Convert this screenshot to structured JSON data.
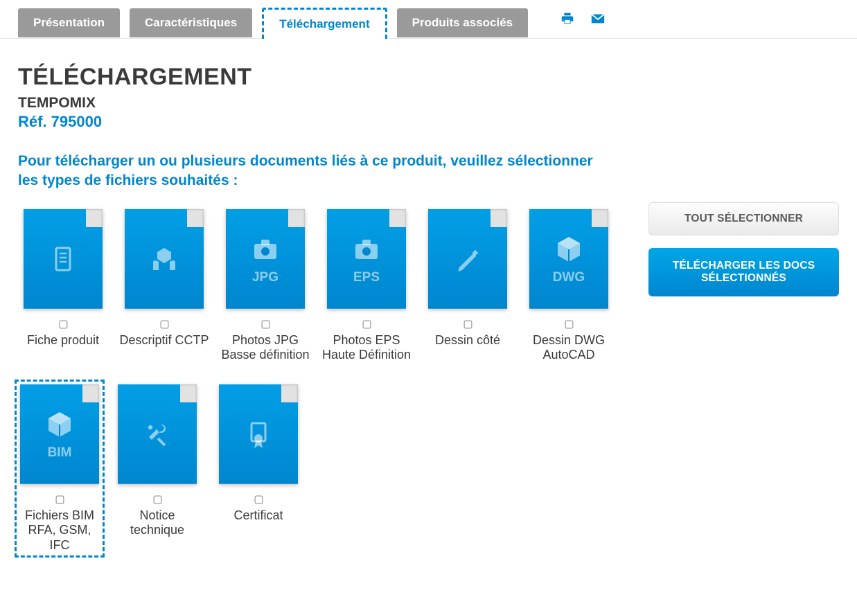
{
  "tabs": [
    {
      "label": "Présentation",
      "active": false
    },
    {
      "label": "Caractéristiques",
      "active": false
    },
    {
      "label": "Téléchargement",
      "active": true
    },
    {
      "label": "Produits associés",
      "active": false
    }
  ],
  "header": {
    "title": "TÉLÉCHARGEMENT",
    "product": "TEMPOMIX",
    "reference": "Réf. 795000",
    "instructions": "Pour télécharger un ou plusieurs documents liés à ce produit, veuillez sélectionner les types de fichiers souhaités :"
  },
  "docs": [
    {
      "label": "Fiche produit",
      "icon": "doc",
      "ext": "",
      "highlighted": false
    },
    {
      "label": "Descriptif CCTP",
      "icon": "hands-box",
      "ext": "",
      "highlighted": false
    },
    {
      "label": "Photos JPG Basse définition",
      "icon": "camera",
      "ext": "JPG",
      "highlighted": false
    },
    {
      "label": "Photos EPS Haute Définition",
      "icon": "camera",
      "ext": "EPS",
      "highlighted": false
    },
    {
      "label": "Dessin côté",
      "icon": "pencil",
      "ext": "",
      "highlighted": false
    },
    {
      "label": "Dessin DWG AutoCAD",
      "icon": "cube",
      "ext": "DWG",
      "highlighted": false
    },
    {
      "label": "Fichiers BIM RFA, GSM, IFC",
      "icon": "cube",
      "ext": "BIM",
      "highlighted": true
    },
    {
      "label": "Notice technique",
      "icon": "tools",
      "ext": "",
      "highlighted": false
    },
    {
      "label": "Certificat",
      "icon": "certificate",
      "ext": "",
      "highlighted": false
    }
  ],
  "buttons": {
    "select_all": "TOUT SÉLECTIONNER",
    "download": "TÉLÉCHARGER LES DOCS SÉLECTIONNÉS"
  }
}
